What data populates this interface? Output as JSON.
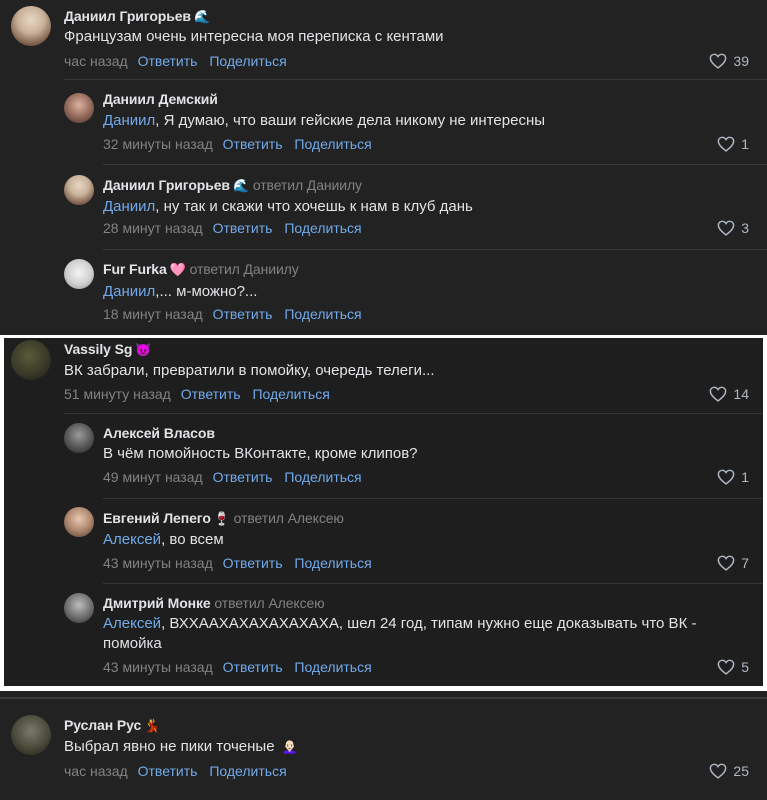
{
  "blocks": [
    {
      "top": {
        "author": "Даниил Григорьев",
        "emoji": "🌊",
        "text": "Французам очень интересна моя переписка с кентами",
        "time": "час назад",
        "reply": "Ответить",
        "share": "Поделиться",
        "likes": "39"
      },
      "replies": [
        {
          "author": "Даниил Демский",
          "replied_to": "",
          "mention": "Даниил",
          "text": ", Я думаю, что ваши гейские дела никому не интересны",
          "time": "32 минуты назад",
          "reply": "Ответить",
          "share": "Поделиться",
          "likes": "1"
        },
        {
          "author": "Даниил Григорьев",
          "emoji": "🌊",
          "replied_to": "ответил Даниилу",
          "mention": "Даниил",
          "text": ", ну так и скажи что хочешь к нам в клуб дань",
          "time": "28 минут назад",
          "reply": "Ответить",
          "share": "Поделиться",
          "likes": "3"
        },
        {
          "author": "Fur Furka",
          "emoji": "🩷",
          "replied_to": "ответил Даниилу",
          "mention": "Даниил",
          "text": ",... м-можно?...",
          "time": "18 минут назад",
          "reply": "Ответить",
          "share": "Поделиться",
          "likes": ""
        }
      ]
    },
    {
      "top": {
        "author": "Vassily Sg",
        "emoji": "😈",
        "text": "ВК забрали, превратили в помойку, очередь телеги...",
        "time": "51 минуту назад",
        "reply": "Ответить",
        "share": "Поделиться",
        "likes": "14"
      },
      "replies": [
        {
          "author": "Алексей Власов",
          "replied_to": "",
          "mention": "",
          "text": "В чём помойность ВКонтакте, кроме клипов?",
          "time": "49 минут назад",
          "reply": "Ответить",
          "share": "Поделиться",
          "likes": "1"
        },
        {
          "author": "Евгений Лепего",
          "emoji": "🍷",
          "replied_to": "ответил Алексею",
          "mention": "Алексей",
          "text": ", во всем",
          "time": "43 минуты назад",
          "reply": "Ответить",
          "share": "Поделиться",
          "likes": "7"
        },
        {
          "author": "Дмитрий Монке",
          "replied_to": "ответил Алексею",
          "mention": "Алексей",
          "text": ", ВХХААХАХАХАХАХАХА, шел 24 год, типам нужно еще доказывать что ВК - помойка",
          "time": "43 минуты назад",
          "reply": "Ответить",
          "share": "Поделиться",
          "likes": "5"
        }
      ]
    },
    {
      "top": {
        "author": "Руслан Рус",
        "emoji": "💃",
        "text": "Выбрал явно не пики точеные",
        "text_emoji": "👩🏻‍🦲",
        "time": "час назад",
        "reply": "Ответить",
        "share": "Поделиться",
        "likes": "25"
      }
    }
  ],
  "colors": {
    "background": "#222222",
    "text": "#e1e3e6",
    "accent": "#71aaeb",
    "muted": "#828282"
  }
}
